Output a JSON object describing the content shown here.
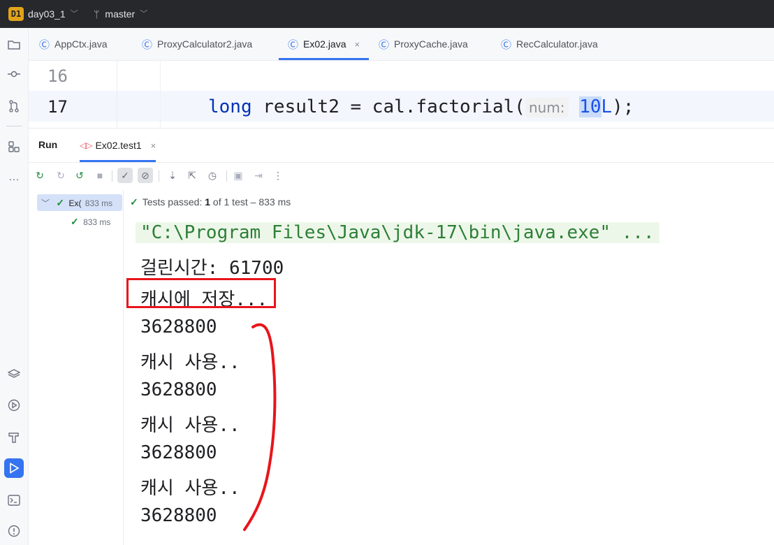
{
  "titlebar": {
    "project_badge": "D1",
    "project_name": "day03_1",
    "branch_name": "master"
  },
  "tabs": [
    {
      "label": "AppCtx.java",
      "icon": "class-icon"
    },
    {
      "label": "ProxyCalculator2.java",
      "icon": "class-icon"
    },
    {
      "label": "Ex02.java",
      "icon": "test-class-icon",
      "active": true
    },
    {
      "label": "ProxyCache.java",
      "icon": "class-icon"
    },
    {
      "label": "RecCalculator.java",
      "icon": "class-icon"
    }
  ],
  "editor": {
    "line_numbers": [
      "16",
      "17"
    ],
    "code": {
      "kw": "long",
      "before_hint": " result2 = cal.factorial(",
      "hint": "num:",
      "arg_highlight": "10",
      "arg_rest": "L",
      "after": ");"
    }
  },
  "run_panel": {
    "label": "Run",
    "tab_label": "Ex02.test1"
  },
  "tree": {
    "root_label": "Ex(",
    "root_time": "833 ms",
    "child_time": "833 ms"
  },
  "status": {
    "prefix": "Tests passed:",
    "passed": "1",
    "of_text": "of",
    "total": "1 test",
    "duration": "– 833 ms"
  },
  "console": {
    "lines": [
      "\"C:\\Program Files\\Java\\jdk-17\\bin\\java.exe\" ...",
      "걸린시간: 61700",
      "캐시에 저장...",
      "3628800",
      "캐시 사용..",
      "3628800",
      "캐시 사용..",
      "3628800",
      "캐시 사용..",
      "3628800"
    ]
  },
  "annotation_colors": {
    "box": "#e8151b",
    "bracket": "#e8151b"
  },
  "colors": {
    "accent": "#3574f0",
    "pass_green": "#208a3c",
    "title_bg": "#27282c"
  }
}
